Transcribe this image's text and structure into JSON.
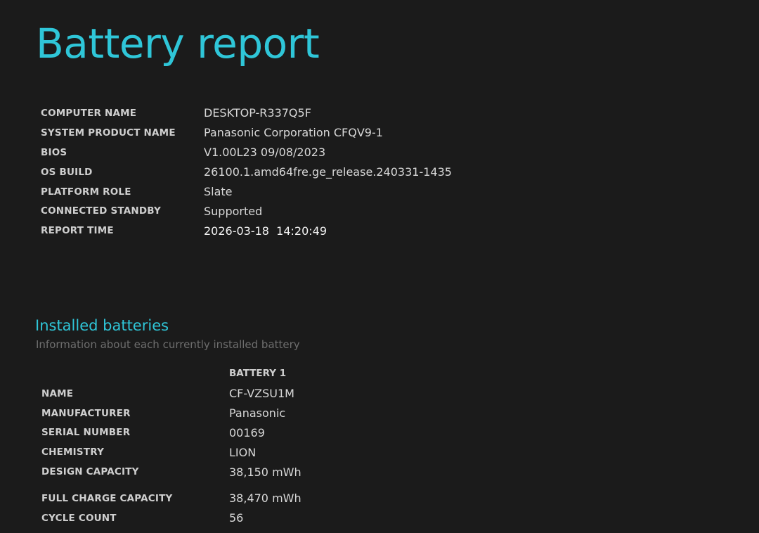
{
  "report": {
    "title": "Battery report"
  },
  "system": [
    {
      "label": "COMPUTER NAME",
      "value": "DESKTOP-R337Q5F"
    },
    {
      "label": "SYSTEM PRODUCT NAME",
      "value": "Panasonic Corporation CFQV9-1"
    },
    {
      "label": "BIOS",
      "value": "V1.00L23 09/08/2023"
    },
    {
      "label": "OS BUILD",
      "value": "26100.1.amd64fre.ge_release.240331-1435"
    },
    {
      "label": "PLATFORM ROLE",
      "value": "Slate"
    },
    {
      "label": "CONNECTED STANDBY",
      "value": "Supported"
    },
    {
      "label": "REPORT TIME",
      "value": "2026-03-18  14:20:49"
    }
  ],
  "installed_batteries": {
    "title": "Installed batteries",
    "subtitle": "Information about each currently installed battery",
    "column_header": "BATTERY 1",
    "rows": [
      {
        "label": "NAME",
        "value": "CF-VZSU1M"
      },
      {
        "label": "MANUFACTURER",
        "value": "Panasonic"
      },
      {
        "label": "SERIAL NUMBER",
        "value": "00169"
      },
      {
        "label": "CHEMISTRY",
        "value": "LION"
      },
      {
        "label": "DESIGN CAPACITY",
        "value": "38,150 mWh"
      },
      {
        "label": "FULL CHARGE CAPACITY",
        "value": "38,470 mWh"
      },
      {
        "label": "CYCLE COUNT",
        "value": "56"
      }
    ]
  },
  "colors": {
    "background": "#1b1b1b",
    "accent": "#2fc6d8",
    "label": "#cfcfcf",
    "value": "#d8d8d8",
    "subtitle": "#6e6e6e"
  }
}
